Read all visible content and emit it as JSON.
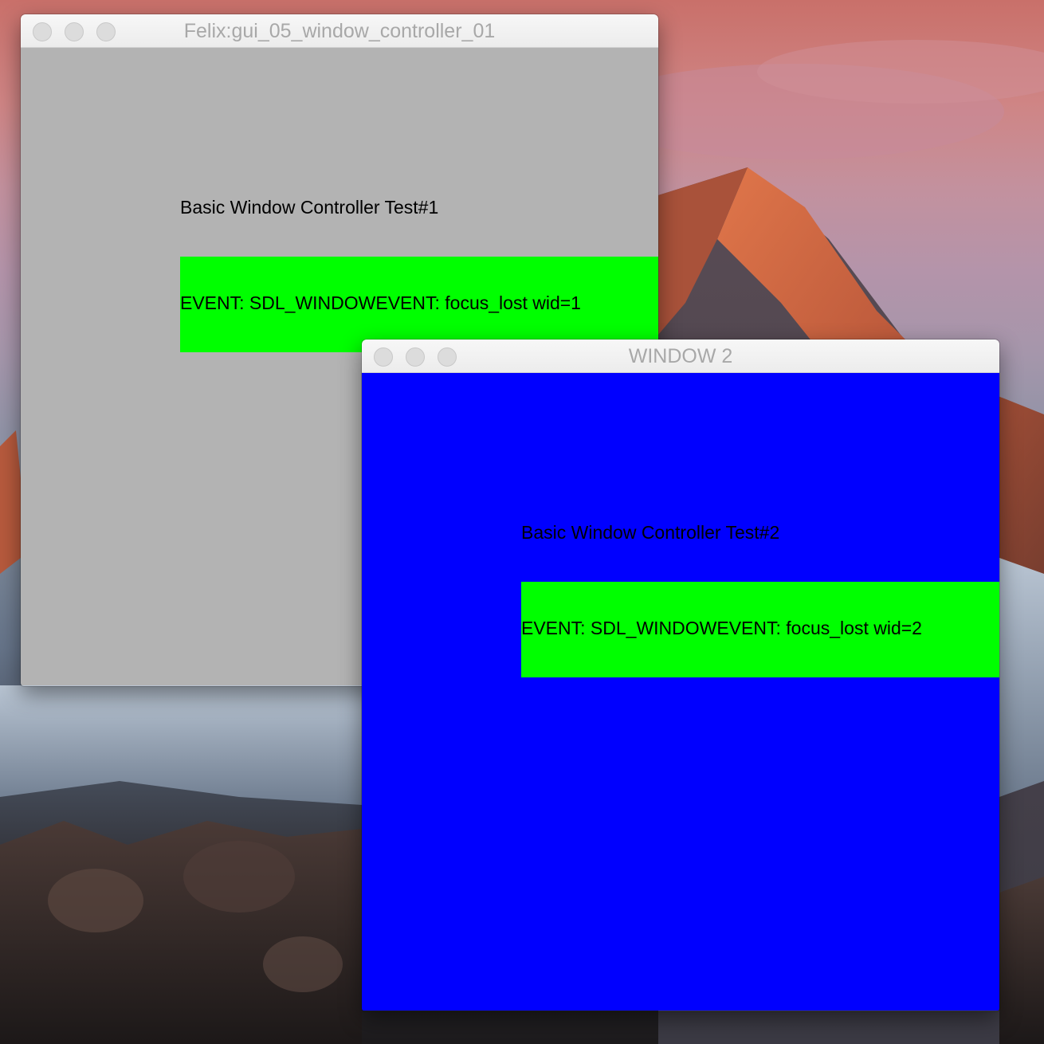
{
  "colors": {
    "window1_background": "#b3b3b3",
    "window2_background": "#0000ff",
    "event_bar": "#00ff00",
    "text": "#000000",
    "titlebar_text": "#a8a8a8",
    "traffic_light_inactive": "#dcdcdc"
  },
  "window1": {
    "title": "Felix:gui_05_window_controller_01",
    "heading": "Basic Window Controller Test#1",
    "event": "EVENT: SDL_WINDOWEVENT: focus_lost wid=1",
    "traffic_lights": [
      "close-button",
      "minimize-button",
      "zoom-button"
    ]
  },
  "window2": {
    "title": "WINDOW 2",
    "heading": "Basic Window Controller Test#2",
    "event": "EVENT: SDL_WINDOWEVENT: focus_lost wid=2",
    "traffic_lights": [
      "close-button",
      "minimize-button",
      "zoom-button"
    ]
  }
}
